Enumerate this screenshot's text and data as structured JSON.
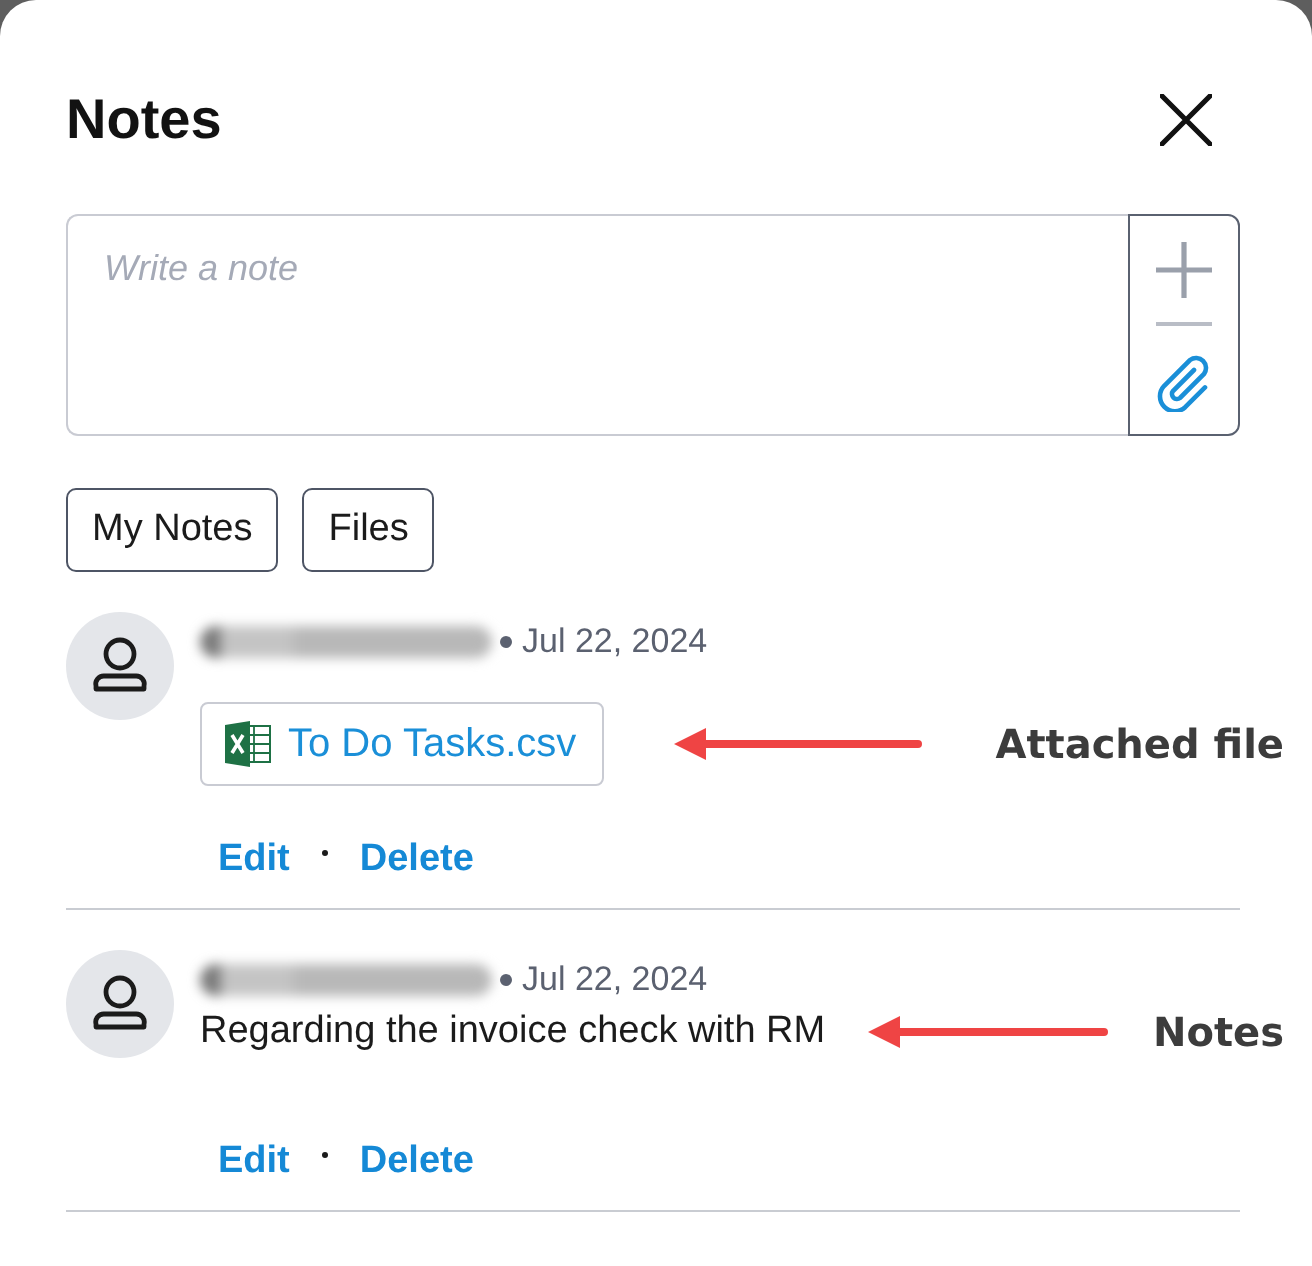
{
  "dialog": {
    "title": "Notes"
  },
  "composer": {
    "placeholder": "Write a note"
  },
  "filters": [
    {
      "label": "My Notes"
    },
    {
      "label": "Files"
    }
  ],
  "notes": [
    {
      "kind": "file",
      "date": "Jul 22, 2024",
      "file": "To Do Tasks.csv",
      "actions": [
        "Edit",
        "Delete"
      ],
      "annotation": "Attached file"
    },
    {
      "kind": "text",
      "date": "Jul 22, 2024",
      "text": "Regarding the invoice check with RM",
      "actions": [
        "Edit",
        "Delete"
      ],
      "annotation": "Notes"
    }
  ]
}
